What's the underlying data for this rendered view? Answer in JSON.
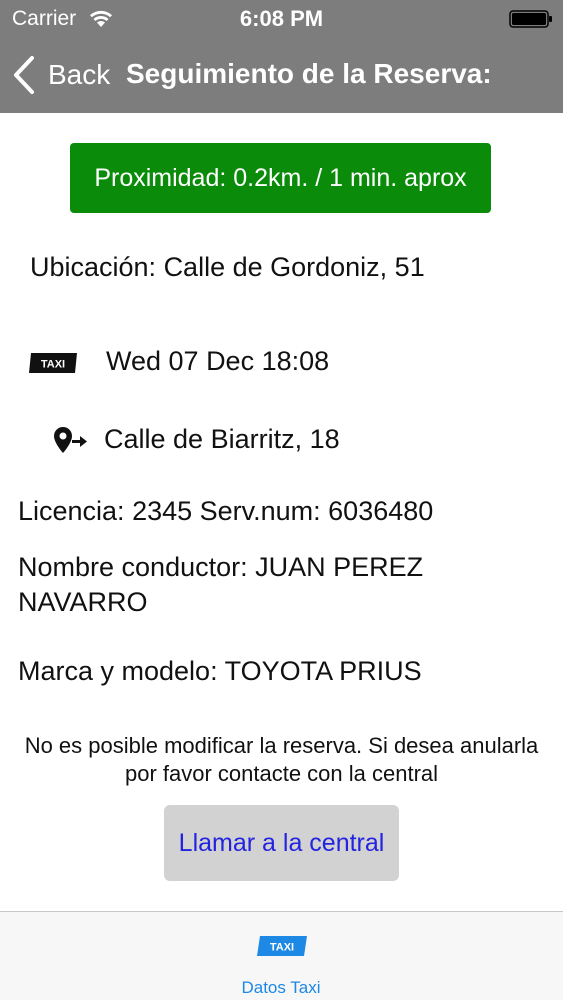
{
  "status_bar": {
    "carrier": "Carrier",
    "time": "6:08 PM",
    "wifi_icon": "wifi-icon",
    "battery_icon": "battery-icon"
  },
  "nav": {
    "back_label": "Back",
    "title": "Seguimiento de la Reserva:"
  },
  "proximity": {
    "text": "Proximidad: 0.2km. / 1 min. aprox",
    "color": "#0a8c0a"
  },
  "details": {
    "location": "Ubicación: Calle de Gordoniz, 51",
    "datetime": "Wed 07 Dec 18:08",
    "destination": "Calle de Biarritz, 18",
    "licence_line": "Licencia: 2345  Serv.num: 6036480",
    "driver": "Nombre conductor: JUAN PEREZ NAVARRO",
    "vehicle": "Marca y modelo: TOYOTA PRIUS",
    "taxi_badge_text": "TAXI"
  },
  "notice": "No es posible modificar la reserva. Si desea anularla por favor contacte con la central",
  "call_button": {
    "label": "Llamar a la central"
  },
  "tab_bar": {
    "items": [
      {
        "label": "Datos Taxi",
        "icon": "taxi-badge-icon",
        "badge_text": "TAXI",
        "color": "#1e88e5"
      }
    ]
  }
}
